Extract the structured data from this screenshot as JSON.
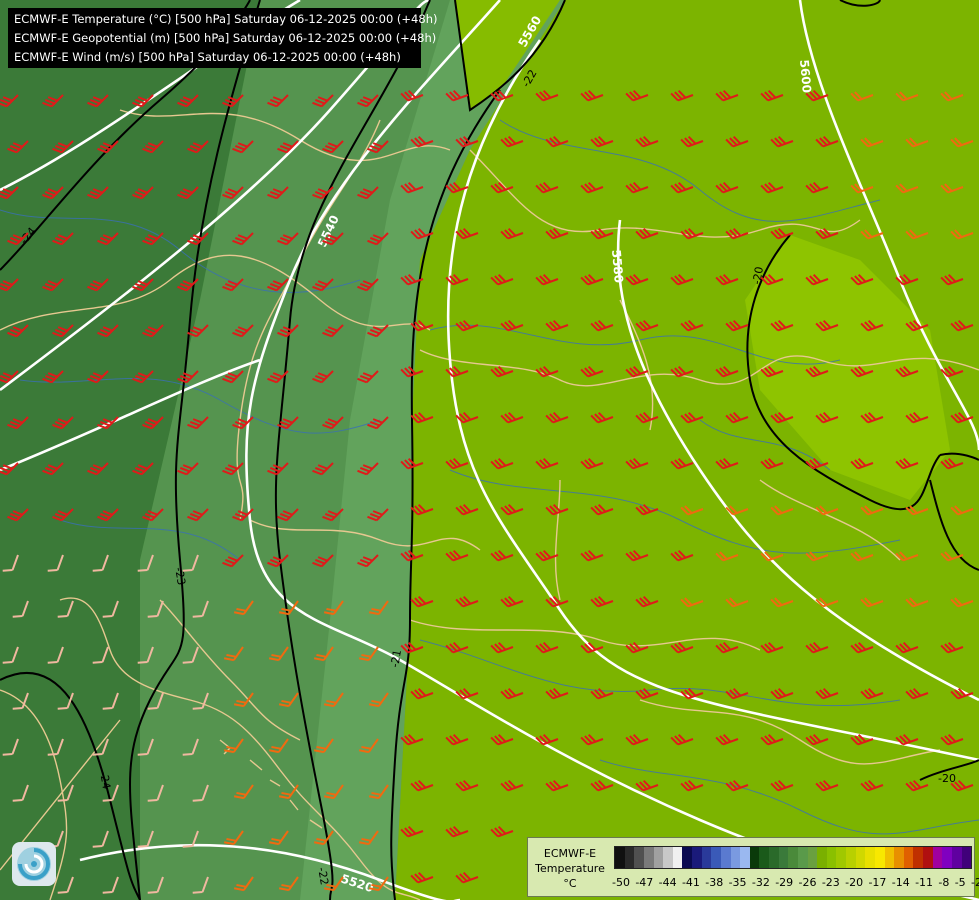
{
  "header": {
    "lines": [
      "ECMWF-E Temperature (°C) [500 hPa] Saturday 06-12-2025 00:00 (+48h)",
      "ECMWF-E Geopotential (m) [500 hPa] Saturday 06-12-2025 00:00 (+48h)",
      "ECMWF-E Wind (m/s) [500 hPa] Saturday 06-12-2025 00:00 (+48h)"
    ]
  },
  "map": {
    "geopotential_labels": [
      "5520",
      "5540",
      "5560",
      "5580",
      "5600"
    ],
    "temperature_labels": [
      "-24",
      "-23",
      "-22",
      "-21",
      "-20",
      "-24",
      "-22",
      "-21",
      "-20"
    ],
    "wind_colors": {
      "strong": "#e01a1a",
      "moderate": "#f06a10",
      "light": "#f0b8a0"
    }
  },
  "legend": {
    "title_line1": "ECMWF-E",
    "title_line2": "Temperature",
    "unit": "°C",
    "ticks": [
      "-50",
      "-47",
      "-44",
      "-41",
      "-38",
      "-35",
      "-32",
      "-29",
      "-26",
      "-23",
      "-20",
      "-17",
      "-14",
      "-11",
      "-8",
      "-5",
      "-2"
    ],
    "colors": [
      "#101010",
      "#2a2a2a",
      "#505050",
      "#7a7a7a",
      "#a0a0a0",
      "#c8c8c8",
      "#f0f0f0",
      "#0a0a50",
      "#1a1a7a",
      "#2a3a9a",
      "#3a5ab8",
      "#5a7ad0",
      "#7a9ae0",
      "#9ab8f0",
      "#0a3a0a",
      "#1a5a1a",
      "#2a6a2a",
      "#3a7a3a",
      "#4a8a3a",
      "#5a9a4a",
      "#6aa040",
      "#7ab000",
      "#8ac000",
      "#a0c800",
      "#b8d000",
      "#d0d800",
      "#e8e000",
      "#f8e800",
      "#f0c000",
      "#e89000",
      "#e06000",
      "#c03000",
      "#b01010",
      "#a000a0",
      "#8000c0",
      "#6000a0",
      "#40007a"
    ]
  },
  "logo": {
    "icon": "ecmwf-swirl-logo"
  }
}
